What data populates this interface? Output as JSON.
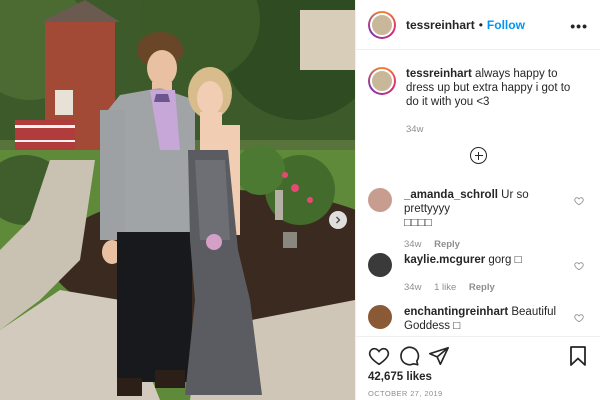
{
  "post": {
    "username": "tessreinhart",
    "follow_label": "Follow",
    "separator": "•"
  },
  "caption": {
    "username": "tessreinhart",
    "text": "always happy to dress up but extra happy i got to do it with you <3",
    "time": "34w"
  },
  "comments": [
    {
      "username": "_amanda_schroll",
      "text": "Ur so prettyyyy",
      "emoji": "□□□□",
      "time": "34w",
      "likes": "",
      "reply_label": "Reply",
      "avatar_color": "#c79d8f"
    },
    {
      "username": "kaylie.mcgurer",
      "text": "gorg",
      "emoji": "□",
      "time": "34w",
      "likes": "1 like",
      "reply_label": "Reply",
      "avatar_color": "#3a3a3a"
    },
    {
      "username": "enchantingreinhart",
      "text": "Beautiful Goddess",
      "emoji": "□",
      "time": "",
      "likes": "",
      "reply_label": "",
      "avatar_color": "#8a5a36"
    }
  ],
  "likes_text": "42,675 likes",
  "date_text": "OCTOBER 27, 2019",
  "icons": {
    "more": "more-options-icon",
    "add_comment": "add-circle-icon",
    "like": "heart-icon",
    "comment": "comment-icon",
    "share": "share-icon",
    "save": "bookmark-icon",
    "next": "chevron-right-icon"
  },
  "colors": {
    "accent": "#0095f6",
    "text": "#262626",
    "muted": "#8e8e8e"
  }
}
